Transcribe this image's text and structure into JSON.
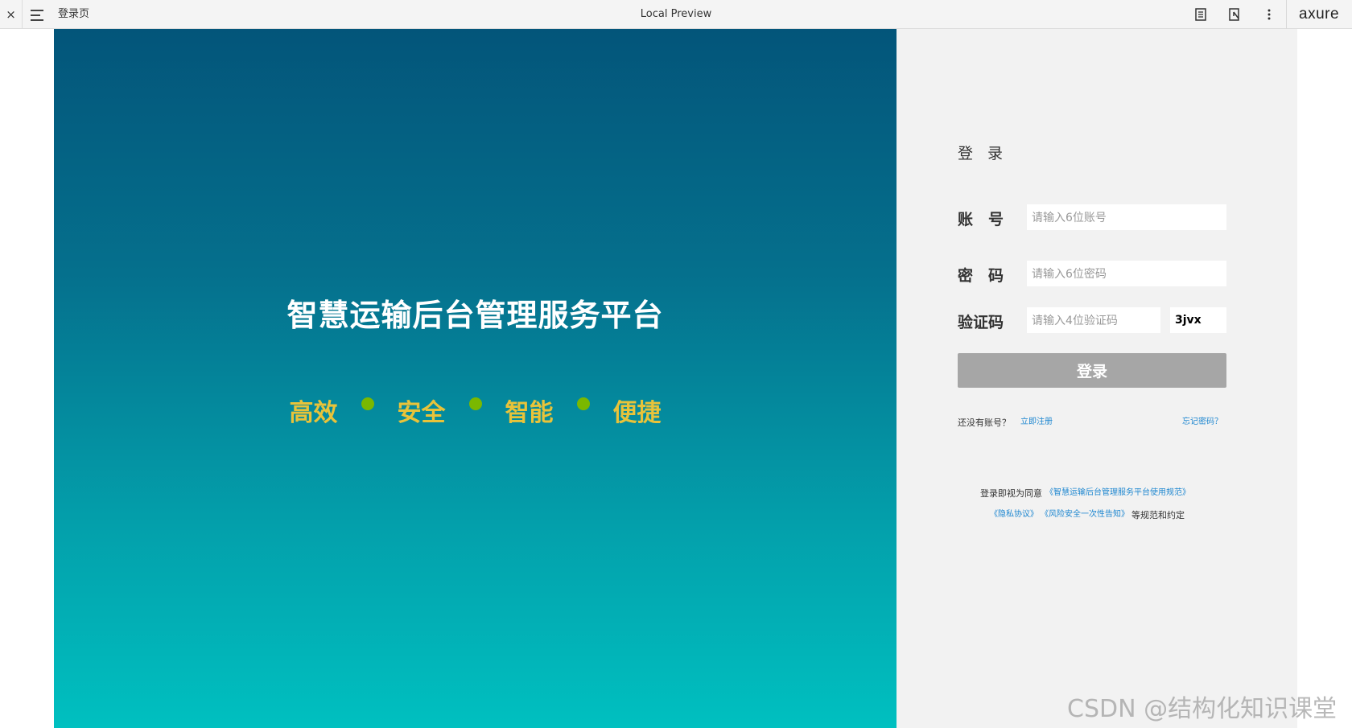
{
  "toolbar": {
    "close_glyph": "×",
    "page_name": "登录页",
    "title": "Local Preview",
    "logo": "axure"
  },
  "hero": {
    "title": "智慧运输后台管理服务平台",
    "tags": [
      "高效",
      "安全",
      "智能",
      "便捷"
    ],
    "tag_color": "#e8c33a",
    "dot_color": "#7ab800"
  },
  "login": {
    "heading": "登 录",
    "account_label": "账　号",
    "account_placeholder": "请输入6位账号",
    "password_label": "密　码",
    "password_placeholder": "请输入6位密码",
    "captcha_label": "验证码",
    "captcha_placeholder": "请输入4位验证码",
    "captcha_code": "3jvx",
    "submit_label": "登录",
    "no_account_text": "还没有账号？",
    "register_link": "立即注册",
    "forgot_link": "忘记密码？",
    "agreement_prefix": "登录即视为同意",
    "agreement_link_1": "《智慧运输后台管理服务平台使用规范》",
    "agreement_link_2": "《隐私协议》",
    "agreement_link_3": "《风险安全一次性告知》",
    "agreement_suffix": "等规范和约定"
  },
  "watermark": "CSDN @结构化知识课堂"
}
